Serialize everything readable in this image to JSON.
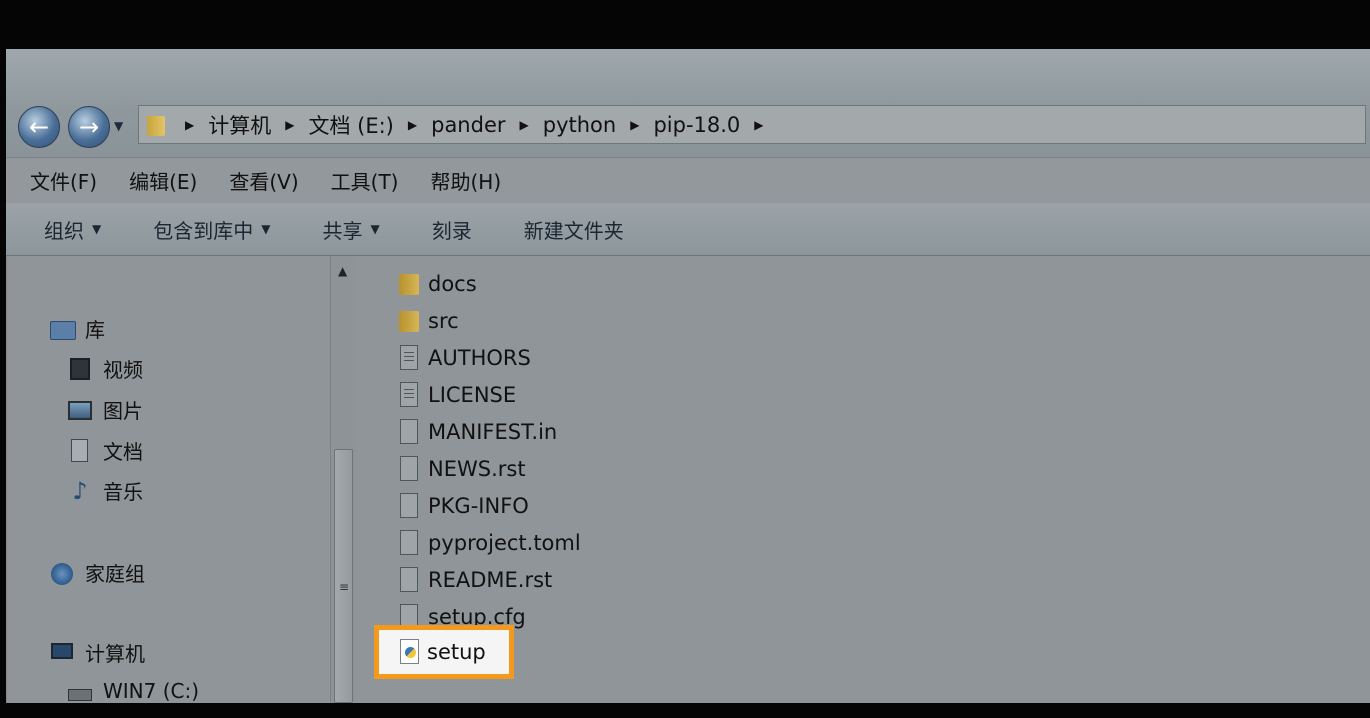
{
  "address_bar": {
    "crumbs": [
      "计算机",
      "文档 (E:)",
      "pander",
      "python",
      "pip-18.0"
    ]
  },
  "menu": {
    "items": [
      "文件(F)",
      "编辑(E)",
      "查看(V)",
      "工具(T)",
      "帮助(H)"
    ]
  },
  "toolbar": {
    "organize": "组织",
    "include_in_library": "包含到库中",
    "share": "共享",
    "burn": "刻录",
    "new_folder": "新建文件夹"
  },
  "nav": {
    "libraries": "库",
    "videos": "视频",
    "pictures": "图片",
    "documents": "文档",
    "music": "音乐",
    "homegroup": "家庭组",
    "computer": "计算机",
    "drive_c": "WIN7 (C:)"
  },
  "files": [
    {
      "name": "docs",
      "icon": "folder-icon"
    },
    {
      "name": "src",
      "icon": "folder-icon"
    },
    {
      "name": "AUTHORS",
      "icon": "text-file-icon"
    },
    {
      "name": "LICENSE",
      "icon": "text-file-icon"
    },
    {
      "name": "MANIFEST.in",
      "icon": "file-icon"
    },
    {
      "name": "NEWS.rst",
      "icon": "file-icon"
    },
    {
      "name": "PKG-INFO",
      "icon": "file-icon"
    },
    {
      "name": "pyproject.toml",
      "icon": "file-icon"
    },
    {
      "name": "README.rst",
      "icon": "file-icon"
    },
    {
      "name": "setup.cfg",
      "icon": "file-icon"
    }
  ],
  "highlighted_file": {
    "name": "setup",
    "icon": "python-file-icon"
  },
  "colors": {
    "highlight_border": "#f39a1e"
  }
}
